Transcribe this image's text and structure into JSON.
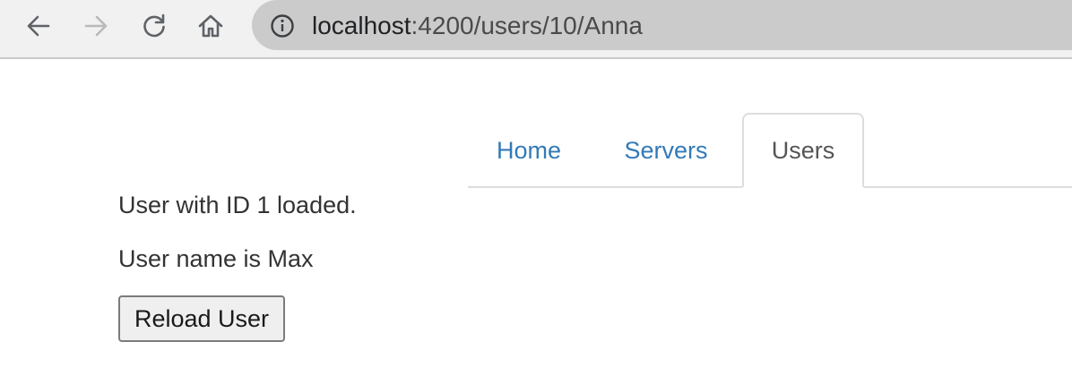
{
  "browser": {
    "back_icon": "arrow-left-icon",
    "forward_icon": "arrow-right-icon",
    "reload_icon": "reload-icon",
    "home_icon": "home-icon",
    "info_icon": "info-icon",
    "url_host": "localhost",
    "url_rest": ":4200/users/10/Anna"
  },
  "nav": {
    "tabs": [
      {
        "label": "Home",
        "active": false
      },
      {
        "label": "Servers",
        "active": false
      },
      {
        "label": "Users",
        "active": true
      }
    ]
  },
  "main": {
    "loaded_message": "User with ID 1 loaded.",
    "name_message": "User name is Max",
    "reload_button_label": "Reload User"
  },
  "colors": {
    "link": "#337ab7",
    "active_tab_text": "#555555",
    "text": "#333333"
  }
}
